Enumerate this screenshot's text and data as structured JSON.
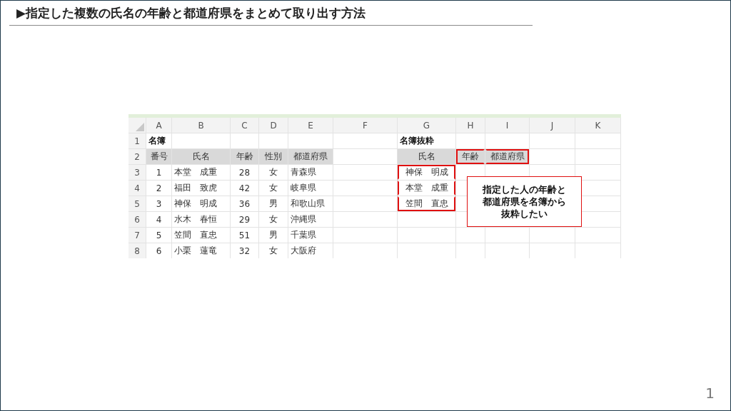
{
  "title": "▶指定した複数の氏名の年齢と都道府県をまとめて取り出す方法",
  "sheet": {
    "columns": [
      "A",
      "B",
      "C",
      "D",
      "E",
      "F",
      "G",
      "H",
      "I",
      "J",
      "K"
    ],
    "rows": [
      {
        "number": "1",
        "cells": [
          {
            "text": "名簿",
            "kind": "title"
          },
          null,
          null,
          null,
          null,
          null,
          {
            "text": "名簿抜粋",
            "kind": "title"
          },
          null,
          null,
          null,
          null
        ]
      },
      {
        "number": "2",
        "cells": [
          {
            "text": "番号",
            "kind": "header"
          },
          {
            "text": "氏名",
            "kind": "header"
          },
          {
            "text": "年齢",
            "kind": "header"
          },
          {
            "text": "性別",
            "kind": "header"
          },
          {
            "text": "都道府県",
            "kind": "header"
          },
          null,
          {
            "text": "氏名",
            "kind": "header"
          },
          {
            "text": "年齢",
            "kind": "header",
            "highlighted": true
          },
          {
            "text": "都道府県",
            "kind": "header",
            "highlighted": true
          },
          null,
          null
        ]
      },
      {
        "number": "3",
        "cells": [
          {
            "text": "1",
            "kind": "center"
          },
          {
            "text": "本堂　成重",
            "kind": "text"
          },
          {
            "text": "28",
            "kind": "center"
          },
          {
            "text": "女",
            "kind": "center"
          },
          {
            "text": "青森県",
            "kind": "text"
          },
          null,
          {
            "text": "神保　明成",
            "kind": "center",
            "highlighted": true
          },
          null,
          null,
          null,
          null
        ]
      },
      {
        "number": "4",
        "cells": [
          {
            "text": "2",
            "kind": "center"
          },
          {
            "text": "福田　致虎",
            "kind": "text"
          },
          {
            "text": "42",
            "kind": "center"
          },
          {
            "text": "女",
            "kind": "center"
          },
          {
            "text": "岐阜県",
            "kind": "text"
          },
          null,
          {
            "text": "本堂　成重",
            "kind": "center",
            "highlighted": true
          },
          null,
          null,
          null,
          null
        ]
      },
      {
        "number": "5",
        "cells": [
          {
            "text": "3",
            "kind": "center"
          },
          {
            "text": "神保　明成",
            "kind": "text"
          },
          {
            "text": "36",
            "kind": "center"
          },
          {
            "text": "男",
            "kind": "center"
          },
          {
            "text": "和歌山県",
            "kind": "text"
          },
          null,
          {
            "text": "笠間　直忠",
            "kind": "center",
            "highlighted": true
          },
          null,
          null,
          null,
          null
        ]
      },
      {
        "number": "6",
        "cells": [
          {
            "text": "4",
            "kind": "center"
          },
          {
            "text": "水木　春恒",
            "kind": "text"
          },
          {
            "text": "29",
            "kind": "center"
          },
          {
            "text": "女",
            "kind": "center"
          },
          {
            "text": "沖縄県",
            "kind": "text"
          },
          null,
          null,
          null,
          null,
          null,
          null
        ]
      },
      {
        "number": "7",
        "cells": [
          {
            "text": "5",
            "kind": "center"
          },
          {
            "text": "笠間　直忠",
            "kind": "text"
          },
          {
            "text": "51",
            "kind": "center"
          },
          {
            "text": "男",
            "kind": "center"
          },
          {
            "text": "千葉県",
            "kind": "text"
          },
          null,
          null,
          null,
          null,
          null,
          null
        ]
      },
      {
        "number": "8",
        "cells": [
          {
            "text": "6",
            "kind": "center"
          },
          {
            "text": "小栗　蓮竜",
            "kind": "text"
          },
          {
            "text": "32",
            "kind": "center"
          },
          {
            "text": "女",
            "kind": "center"
          },
          {
            "text": "大阪府",
            "kind": "text"
          },
          null,
          null,
          null,
          null,
          null,
          null
        ]
      }
    ]
  },
  "callout": {
    "lines": [
      "指定した人の年齢と",
      "都道府県を名簿から",
      "抜粋したい"
    ]
  },
  "page_number": "1"
}
